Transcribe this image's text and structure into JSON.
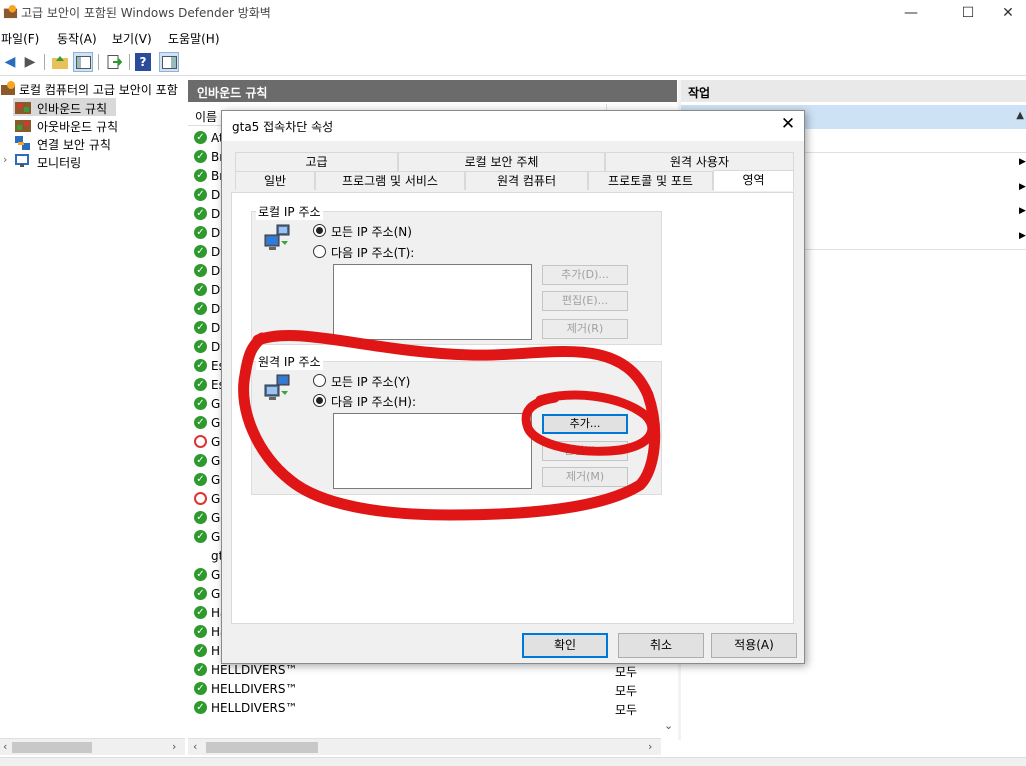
{
  "window": {
    "title": "고급 보안이 포함된 Windows Defender 방화벽",
    "controls": {
      "minimize": "—",
      "maximize": "☐",
      "close": "✕"
    }
  },
  "menu": [
    "파일(F)",
    "동작(A)",
    "보기(V)",
    "도움말(H)"
  ],
  "tree": {
    "root": "로컬 컴퓨터의 고급 보안이 포함",
    "items": [
      "인바운드 규칙",
      "아웃바운드 규칙",
      "연결 보안 규칙",
      "모니터링"
    ]
  },
  "middle": {
    "header": "인바운드 규칙",
    "col_name": "이름",
    "rows": [
      {
        "name": "At",
        "status": "ok",
        "profile": ""
      },
      {
        "name": "Br",
        "status": "ok",
        "profile": ""
      },
      {
        "name": "Br",
        "status": "ok",
        "profile": ""
      },
      {
        "name": "DE",
        "status": "ok",
        "profile": ""
      },
      {
        "name": "DE",
        "status": "ok",
        "profile": ""
      },
      {
        "name": "Dy",
        "status": "ok",
        "profile": ""
      },
      {
        "name": "Dy",
        "status": "ok",
        "profile": ""
      },
      {
        "name": "Dy",
        "status": "ok",
        "profile": ""
      },
      {
        "name": "Dy",
        "status": "ok",
        "profile": ""
      },
      {
        "name": "Dy",
        "status": "ok",
        "profile": ""
      },
      {
        "name": "Dy",
        "status": "ok",
        "profile": ""
      },
      {
        "name": "Dy",
        "status": "ok",
        "profile": ""
      },
      {
        "name": "Es",
        "status": "ok",
        "profile": ""
      },
      {
        "name": "Es",
        "status": "ok",
        "profile": ""
      },
      {
        "name": "Gr",
        "status": "ok",
        "profile": ""
      },
      {
        "name": "Gr",
        "status": "ok",
        "profile": ""
      },
      {
        "name": "Gr",
        "status": "block",
        "profile": ""
      },
      {
        "name": "Gr",
        "status": "ok",
        "profile": ""
      },
      {
        "name": "Gr",
        "status": "ok",
        "profile": ""
      },
      {
        "name": "Gr",
        "status": "block",
        "profile": ""
      },
      {
        "name": "Gr",
        "status": "ok",
        "profile": ""
      },
      {
        "name": "Gr",
        "status": "ok",
        "profile": ""
      },
      {
        "name": "gta",
        "status": "none",
        "profile": ""
      },
      {
        "name": "Gu",
        "status": "ok",
        "profile": ""
      },
      {
        "name": "Gu",
        "status": "ok",
        "profile": ""
      },
      {
        "name": "Ha",
        "status": "ok",
        "profile": ""
      },
      {
        "name": "Ha",
        "status": "ok",
        "profile": ""
      },
      {
        "name": "HELLDIVERS™",
        "status": "ok",
        "profile": "모두"
      },
      {
        "name": "HELLDIVERS™",
        "status": "ok",
        "profile": "모두"
      },
      {
        "name": "HELLDIVERS™",
        "status": "ok",
        "profile": "모두"
      },
      {
        "name": "HELLDIVERS™",
        "status": "ok",
        "profile": "모두"
      }
    ]
  },
  "actions": {
    "header": "작업"
  },
  "dialog": {
    "title": "gta5 접속차단 속성",
    "tabs_row1": [
      "고급",
      "로컬 보안 주체",
      "원격 사용자"
    ],
    "tabs_row2": [
      "일반",
      "프로그램 및 서비스",
      "원격 컴퓨터",
      "프로토콜 및 포트",
      "영역"
    ],
    "local": {
      "label": "로컬 IP 주소",
      "any": "모든 IP 주소(N)",
      "these": "다음 IP 주소(T):",
      "add": "추가(D)...",
      "edit": "편집(E)...",
      "remove": "제거(R)"
    },
    "remote": {
      "label": "원격 IP 주소",
      "any": "모든 IP 주소(Y)",
      "these": "다음 IP 주소(H):",
      "add": "추가...",
      "edit": "편집(I)...",
      "remove": "제거(M)"
    },
    "ok": "확인",
    "cancel": "취소",
    "apply": "적용(A)"
  },
  "colors": {
    "annotation": "#e01515",
    "accent": "#0078d7"
  }
}
